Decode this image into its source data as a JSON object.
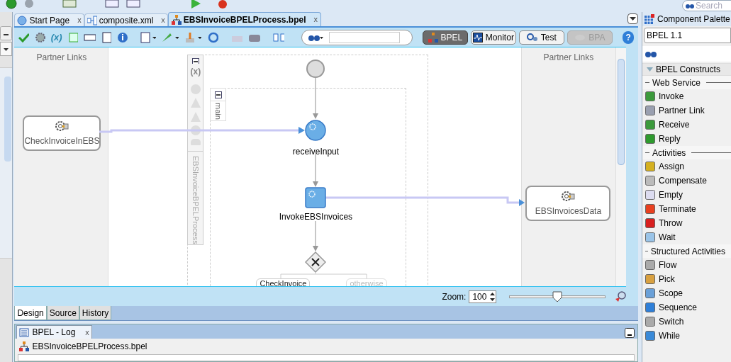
{
  "top_toolbar": {
    "search_placeholder": "Search"
  },
  "editor_toolbar": {
    "variable_glyph": "(x)",
    "help_glyph": "?"
  },
  "editor_tabs": [
    {
      "label": "Start Page",
      "close": "x",
      "selected": false
    },
    {
      "label": "composite.xml",
      "close": "x",
      "selected": false
    },
    {
      "label": "EBSInvoiceBPELProcess.bpel",
      "close": "x",
      "selected": true
    }
  ],
  "modes": [
    {
      "label": "BPEL",
      "selected": true,
      "disabled": false
    },
    {
      "label": "Monitor",
      "selected": false,
      "disabled": false
    },
    {
      "label": "Test",
      "selected": false,
      "disabled": false
    },
    {
      "label": "BPA",
      "selected": false,
      "disabled": true
    }
  ],
  "canvas": {
    "left_lane": {
      "title": "Partner Links",
      "partner_links": [
        "CheckInvoiceInEBS"
      ]
    },
    "right_lane": {
      "title": "Partner Links",
      "partner_links": [
        "EBSInvoicesData"
      ]
    },
    "process": {
      "name": "EBSInvoiceBPELProcess",
      "scope": "main",
      "variables_glyph": "(x)",
      "activities": [
        {
          "kind": "receive",
          "label": "receiveInput"
        },
        {
          "kind": "invoke",
          "label": "InvokeEBSInvoices"
        },
        {
          "kind": "switch"
        }
      ],
      "cases": [
        "CheckInvoice",
        "otherwise"
      ]
    }
  },
  "zoom": {
    "label": "Zoom:",
    "value": "100",
    "level": 0.5
  },
  "view_tabs": [
    {
      "label": "Design",
      "selected": true
    },
    {
      "label": "Source",
      "selected": false
    },
    {
      "label": "History",
      "selected": false
    }
  ],
  "log": {
    "tab": "BPEL - Log",
    "close": "x",
    "item": "EBSInvoiceBPELProcess.bpel"
  },
  "palette": {
    "title": "Component Palette",
    "library": "BPEL 1.1",
    "section": "BPEL Constructs",
    "expanded": true,
    "groups": [
      {
        "name": "Web Service",
        "items": [
          "Invoke",
          "Partner Link",
          "Receive",
          "Reply"
        ]
      },
      {
        "name": "Activities",
        "items": [
          "Assign",
          "Compensate",
          "Empty",
          "Terminate",
          "Throw",
          "Wait"
        ]
      },
      {
        "name": "Structured Activities",
        "items": [
          "Flow",
          "Pick",
          "Scope",
          "Sequence",
          "Switch",
          "While"
        ]
      }
    ]
  }
}
